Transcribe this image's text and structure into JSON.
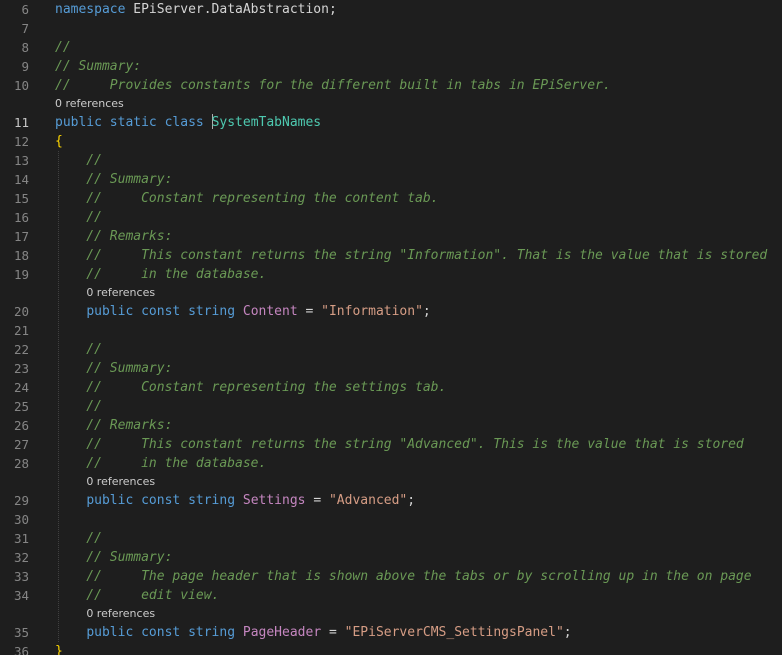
{
  "editor": {
    "lines": [
      {
        "n": "6",
        "tokens": [
          {
            "t": "namespace",
            "c": "kw"
          },
          {
            "t": " EPiServer.DataAbstraction;",
            "c": "ns"
          }
        ]
      },
      {
        "n": "7",
        "tokens": []
      },
      {
        "n": "8",
        "tokens": [
          {
            "t": "//",
            "c": "cmt"
          }
        ]
      },
      {
        "n": "9",
        "tokens": [
          {
            "t": "// Summary:",
            "c": "cmt"
          }
        ]
      },
      {
        "n": "10",
        "tokens": [
          {
            "t": "//     Provides constants for the different built in tabs in EPiServer.",
            "c": "cmt"
          }
        ]
      },
      {
        "n": "11",
        "tokens": [
          {
            "t": "public",
            "c": "kw"
          },
          {
            "t": " ",
            "c": "plain"
          },
          {
            "t": "static",
            "c": "kw"
          },
          {
            "t": " ",
            "c": "plain"
          },
          {
            "t": "class",
            "c": "kw"
          },
          {
            "t": " ",
            "c": "plain"
          },
          {
            "t": "SystemTabNames",
            "c": "cls"
          }
        ]
      },
      {
        "n": "12",
        "tokens": [
          {
            "t": "{",
            "c": "brace"
          }
        ]
      },
      {
        "n": "13",
        "tokens": [
          {
            "t": "    //",
            "c": "cmt"
          }
        ]
      },
      {
        "n": "14",
        "tokens": [
          {
            "t": "    // Summary:",
            "c": "cmt"
          }
        ]
      },
      {
        "n": "15",
        "tokens": [
          {
            "t": "    //     Constant representing the content tab.",
            "c": "cmt"
          }
        ]
      },
      {
        "n": "16",
        "tokens": [
          {
            "t": "    //",
            "c": "cmt"
          }
        ]
      },
      {
        "n": "17",
        "tokens": [
          {
            "t": "    // Remarks:",
            "c": "cmt"
          }
        ]
      },
      {
        "n": "18",
        "tokens": [
          {
            "t": "    //     This constant returns the string \"Information\". That is the value that is stored",
            "c": "cmt"
          }
        ]
      },
      {
        "n": "19",
        "tokens": [
          {
            "t": "    //     in the database.",
            "c": "cmt"
          }
        ]
      },
      {
        "n": "20",
        "tokens": [
          {
            "t": "    ",
            "c": "plain"
          },
          {
            "t": "public",
            "c": "kw"
          },
          {
            "t": " ",
            "c": "plain"
          },
          {
            "t": "const",
            "c": "kw"
          },
          {
            "t": " ",
            "c": "plain"
          },
          {
            "t": "string",
            "c": "kw"
          },
          {
            "t": " ",
            "c": "plain"
          },
          {
            "t": "Content",
            "c": "prop"
          },
          {
            "t": " = ",
            "c": "plain"
          },
          {
            "t": "\"Information\"",
            "c": "str"
          },
          {
            "t": ";",
            "c": "plain"
          }
        ]
      },
      {
        "n": "21",
        "tokens": []
      },
      {
        "n": "22",
        "tokens": [
          {
            "t": "    //",
            "c": "cmt"
          }
        ]
      },
      {
        "n": "23",
        "tokens": [
          {
            "t": "    // Summary:",
            "c": "cmt"
          }
        ]
      },
      {
        "n": "24",
        "tokens": [
          {
            "t": "    //     Constant representing the settings tab.",
            "c": "cmt"
          }
        ]
      },
      {
        "n": "25",
        "tokens": [
          {
            "t": "    //",
            "c": "cmt"
          }
        ]
      },
      {
        "n": "26",
        "tokens": [
          {
            "t": "    // Remarks:",
            "c": "cmt"
          }
        ]
      },
      {
        "n": "27",
        "tokens": [
          {
            "t": "    //     This constant returns the string \"Advanced\". This is the value that is stored",
            "c": "cmt"
          }
        ]
      },
      {
        "n": "28",
        "tokens": [
          {
            "t": "    //     in the database.",
            "c": "cmt"
          }
        ]
      },
      {
        "n": "29",
        "tokens": [
          {
            "t": "    ",
            "c": "plain"
          },
          {
            "t": "public",
            "c": "kw"
          },
          {
            "t": " ",
            "c": "plain"
          },
          {
            "t": "const",
            "c": "kw"
          },
          {
            "t": " ",
            "c": "plain"
          },
          {
            "t": "string",
            "c": "kw"
          },
          {
            "t": " ",
            "c": "plain"
          },
          {
            "t": "Settings",
            "c": "prop"
          },
          {
            "t": " = ",
            "c": "plain"
          },
          {
            "t": "\"Advanced\"",
            "c": "str"
          },
          {
            "t": ";",
            "c": "plain"
          }
        ]
      },
      {
        "n": "30",
        "tokens": []
      },
      {
        "n": "31",
        "tokens": [
          {
            "t": "    //",
            "c": "cmt"
          }
        ]
      },
      {
        "n": "32",
        "tokens": [
          {
            "t": "    // Summary:",
            "c": "cmt"
          }
        ]
      },
      {
        "n": "33",
        "tokens": [
          {
            "t": "    //     The page header that is shown above the tabs or by scrolling up in the on page",
            "c": "cmt"
          }
        ]
      },
      {
        "n": "34",
        "tokens": [
          {
            "t": "    //     edit view.",
            "c": "cmt"
          }
        ]
      },
      {
        "n": "35",
        "tokens": [
          {
            "t": "    ",
            "c": "plain"
          },
          {
            "t": "public",
            "c": "kw"
          },
          {
            "t": " ",
            "c": "plain"
          },
          {
            "t": "const",
            "c": "kw"
          },
          {
            "t": " ",
            "c": "plain"
          },
          {
            "t": "string",
            "c": "kw"
          },
          {
            "t": " ",
            "c": "plain"
          },
          {
            "t": "PageHeader",
            "c": "prop"
          },
          {
            "t": " = ",
            "c": "plain"
          },
          {
            "t": "\"EPiServerCMS_SettingsPanel\"",
            "c": "str"
          },
          {
            "t": ";",
            "c": "plain"
          }
        ]
      },
      {
        "n": "36",
        "tokens": [
          {
            "t": "}",
            "c": "brace"
          }
        ]
      }
    ],
    "codelens": [
      {
        "label": "0 references",
        "before_line": "11"
      },
      {
        "label": "0 references",
        "before_line": "20"
      },
      {
        "label": "0 references",
        "before_line": "29"
      },
      {
        "label": "0 references",
        "before_line": "35"
      }
    ],
    "active_line": "11",
    "colors": {
      "background": "#1e1e1e",
      "keyword": "#569cd6",
      "class_name": "#4ec9b0",
      "member": "#c586c0",
      "string": "#d69d85",
      "comment": "#6a9955",
      "brace": "#ffd700",
      "line_number": "#858585"
    }
  }
}
